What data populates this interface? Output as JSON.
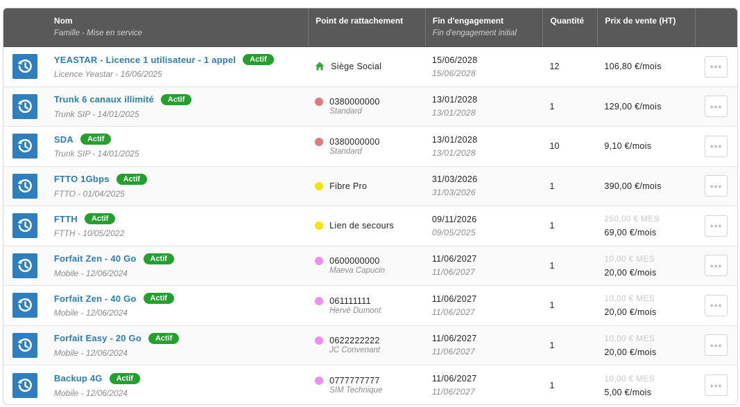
{
  "header": {
    "nom": "Nom",
    "nom_sub": "Famille - Mise en service",
    "point": "Point de rattachement",
    "fin": "Fin d'engagement",
    "fin_sub": "Fin d'engagement initial",
    "quantite": "Quantité",
    "prix": "Prix de vente (HT)"
  },
  "colors": {
    "header_bg": "#595959",
    "link": "#2a7db8",
    "badge": "#22a22c",
    "history_button": "#2f7fbf"
  },
  "rows": [
    {
      "name": "YEASTAR - Licence 1 utilisateur - 1 appel",
      "badge": "Actif",
      "meta": "Licence Yeastar - 16/06/2025",
      "att_icon": "home-icon",
      "att_color": "#3aa53a",
      "att_main": "Siège Social",
      "att_sub": "",
      "fin": "15/06/2028",
      "fin_initial": "15/06/2028",
      "qty": "12",
      "price_mes": "",
      "price": "106,80 €/mois"
    },
    {
      "name": "Trunk 6 canaux illimité",
      "badge": "Actif",
      "meta": "Trunk SIP - 14/01/2025",
      "att_icon": "dot",
      "att_color": "#e07a7a",
      "att_main": "0380000000",
      "att_sub": "Standard",
      "fin": "13/01/2028",
      "fin_initial": "13/01/2028",
      "qty": "1",
      "price_mes": "",
      "price": "129,00 €/mois"
    },
    {
      "name": "SDA",
      "badge": "Actif",
      "meta": "Trunk SIP - 14/01/2025",
      "att_icon": "dot",
      "att_color": "#e07a7a",
      "att_main": "0380000000",
      "att_sub": "Standard",
      "fin": "13/01/2028",
      "fin_initial": "13/01/2028",
      "qty": "10",
      "price_mes": "",
      "price": "9,10 €/mois"
    },
    {
      "name": "FTTO 1Gbps",
      "badge": "Actif",
      "meta": "FTTO - 01/04/2025",
      "att_icon": "dot",
      "att_color": "#f2e600",
      "att_main": "Fibre Pro",
      "att_sub": "",
      "fin": "31/03/2026",
      "fin_initial": "31/03/2026",
      "qty": "1",
      "price_mes": "",
      "price": "390,00 €/mois"
    },
    {
      "name": "FTTH",
      "badge": "Actif",
      "meta": "FTTH - 10/05/2022",
      "att_icon": "dot",
      "att_color": "#f2e600",
      "att_main": "Lien de secours",
      "att_sub": "",
      "fin": "09/11/2026",
      "fin_initial": "09/05/2025",
      "qty": "1",
      "price_mes": "250,00 € MES",
      "price": "69,00 €/mois"
    },
    {
      "name": "Forfait Zen - 40 Go",
      "badge": "Actif",
      "meta": "Mobile - 12/06/2024",
      "att_icon": "dot",
      "att_color": "#f08ef0",
      "att_main": "0600000000",
      "att_sub": "Maeva Capucin",
      "fin": "11/06/2027",
      "fin_initial": "11/06/2027",
      "qty": "1",
      "price_mes": "10,00 € MES",
      "price": "20,00 €/mois"
    },
    {
      "name": "Forfait Zen - 40 Go",
      "badge": "Actif",
      "meta": "Mobile - 12/06/2024",
      "att_icon": "dot",
      "att_color": "#f08ef0",
      "att_main": "061111111",
      "att_sub": "Hervé Dumont",
      "fin": "11/06/2027",
      "fin_initial": "11/06/2027",
      "qty": "1",
      "price_mes": "10,00 € MES",
      "price": "20,00 €/mois"
    },
    {
      "name": "Forfait Easy - 20 Go",
      "badge": "Actif",
      "meta": "Mobile - 12/06/2024",
      "att_icon": "dot",
      "att_color": "#f08ef0",
      "att_main": "0622222222",
      "att_sub": "JC Convenant",
      "fin": "11/06/2027",
      "fin_initial": "11/06/2027",
      "qty": "1",
      "price_mes": "10,00 € MES",
      "price": "20,00 €/mois"
    },
    {
      "name": "Backup 4G",
      "badge": "Actif",
      "meta": "Mobile - 12/06/2024",
      "att_icon": "dot",
      "att_color": "#f08ef0",
      "att_main": "0777777777",
      "att_sub": "SIM Technique",
      "fin": "11/06/2027",
      "fin_initial": "11/06/2027",
      "qty": "1",
      "price_mes": "10,00 € MES",
      "price": "5,00 €/mois"
    }
  ]
}
